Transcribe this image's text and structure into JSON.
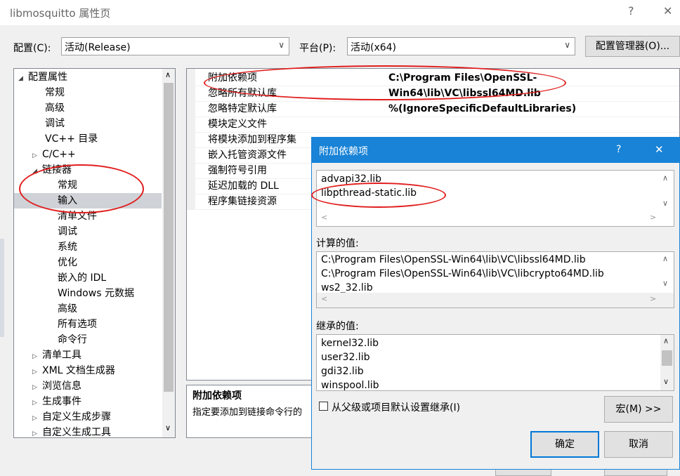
{
  "window": {
    "title": "libmosquitto 属性页",
    "help": "?",
    "close": "✕"
  },
  "config": {
    "label": "配置(C):",
    "value": "活动(Release)"
  },
  "platform": {
    "label": "平台(P):",
    "value": "活动(x64)"
  },
  "config_manager": "配置管理器(O)...",
  "tree": {
    "root": "配置属性",
    "items": [
      "常规",
      "高级",
      "调试",
      "VC++ 目录",
      "C/C++",
      "链接器",
      "常规",
      "输入",
      "清单文件",
      "调试",
      "系统",
      "优化",
      "嵌入的 IDL",
      "Windows 元数据",
      "高级",
      "所有选项",
      "命令行",
      "清单工具",
      "XML 文档生成器",
      "浏览信息",
      "生成事件",
      "自定义生成步骤",
      "自定义生成工具"
    ]
  },
  "props": [
    {
      "name": "附加依赖项",
      "value": "C:\\Program Files\\OpenSSL-Win64\\lib\\VC\\libssl64MD.lib"
    },
    {
      "name": "忽略所有默认库",
      "value": ""
    },
    {
      "name": "忽略特定默认库",
      "value": "%(IgnoreSpecificDefaultLibraries)"
    },
    {
      "name": "模块定义文件",
      "value": ""
    },
    {
      "name": "将模块添加到程序集",
      "value": ""
    },
    {
      "name": "嵌入托管资源文件",
      "value": ""
    },
    {
      "name": "强制符号引用",
      "value": ""
    },
    {
      "name": "延迟加载的 DLL",
      "value": ""
    },
    {
      "name": "程序集链接资源",
      "value": ""
    }
  ],
  "desc": {
    "title": "附加依赖项",
    "text": "指定要添加到链接命令行的"
  },
  "dialog": {
    "title": "附加依赖项",
    "help": "?",
    "close": "✕",
    "edit_lines": [
      "advapi32.lib",
      "libpthread-static.lib"
    ],
    "computed_label": "计算的值:",
    "computed_lines": [
      "C:\\Program Files\\OpenSSL-Win64\\lib\\VC\\libssl64MD.lib",
      "C:\\Program Files\\OpenSSL-Win64\\lib\\VC\\libcrypto64MD.lib",
      "ws2_32.lib"
    ],
    "inherited_label": "继承的值:",
    "inherited_lines": [
      "kernel32.lib",
      "user32.lib",
      "gdi32.lib",
      "winspool.lib"
    ],
    "inherit_checkbox": "从父级或项目默认设置继承(I)",
    "macro_button": "宏(M) >>",
    "ok": "确定",
    "cancel": "取消"
  }
}
